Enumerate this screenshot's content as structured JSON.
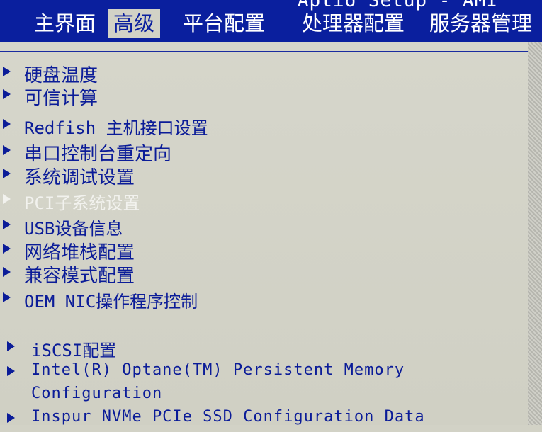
{
  "app_title": "Aptio Setup - AMI",
  "tabs": [
    {
      "label": "主界面"
    },
    {
      "label": "高级"
    },
    {
      "label": "平台配置"
    },
    {
      "label": "处理器配置"
    },
    {
      "label": "服务器管理"
    }
  ],
  "active_tab": "高级",
  "menu": [
    {
      "label": "硬盘温度",
      "enabled": true
    },
    {
      "label": "可信计算",
      "enabled": true
    },
    {
      "label": "Redfish 主机接口设置",
      "enabled": true
    },
    {
      "label": "串口控制台重定向",
      "enabled": true
    },
    {
      "label": "系统调试设置",
      "enabled": true
    },
    {
      "label": "PCI子系统设置",
      "enabled": false
    },
    {
      "label": "USB设备信息",
      "enabled": true
    },
    {
      "label": "网络堆栈配置",
      "enabled": true
    },
    {
      "label": "兼容模式配置",
      "enabled": true
    },
    {
      "label": "OEM NIC操作程序控制",
      "enabled": true
    },
    {
      "label": "iSCSI配置",
      "enabled": true
    },
    {
      "label": "Intel(R) Optane(TM) Persistent Memory",
      "label_line2": "Configuration",
      "enabled": true
    },
    {
      "label": "Inspur NVMe PCIe SSD Configuration Data",
      "enabled": true
    }
  ],
  "colors": {
    "bar_blue": "#0a1f9e",
    "panel_bg": "#d2d2c6",
    "item_text": "#0b1c98",
    "disabled_text": "#f2f2ee"
  }
}
